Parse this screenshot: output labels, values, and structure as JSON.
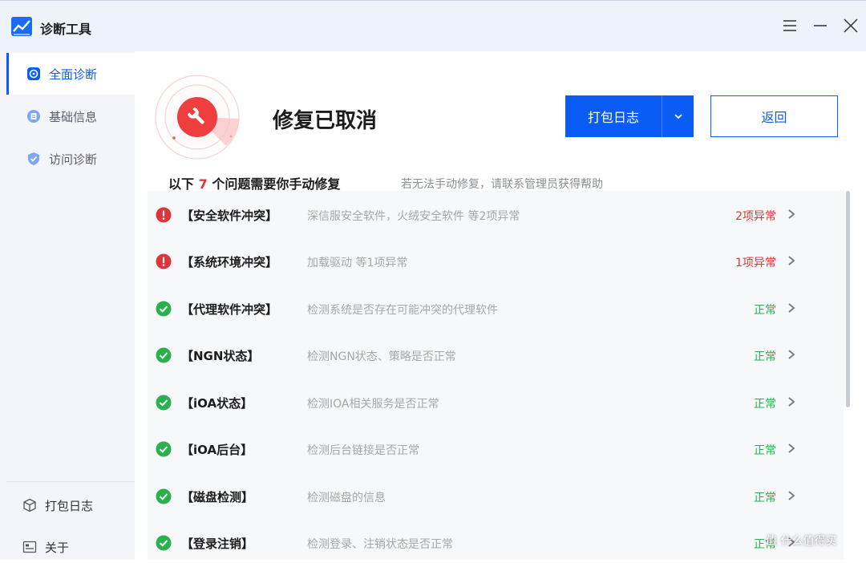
{
  "window": {
    "title": "诊断工具",
    "icons": {
      "app": "chart-line-icon",
      "menu": "menu-icon",
      "minimize": "minimize-icon",
      "close": "close-icon"
    }
  },
  "sidebar": {
    "items": [
      {
        "label": "全面诊断",
        "icon": "diagnose-icon",
        "active": true
      },
      {
        "label": "基础信息",
        "icon": "info-icon",
        "active": false
      },
      {
        "label": "访问诊断",
        "icon": "shield-icon",
        "active": false
      }
    ],
    "bottom": [
      {
        "label": "打包日志",
        "icon": "package-icon"
      },
      {
        "label": "关于",
        "icon": "about-icon"
      }
    ]
  },
  "header": {
    "status_title": "修复已取消",
    "pack_log_button": "打包日志",
    "back_button": "返回"
  },
  "summary": {
    "prefix": "以下",
    "count": "7",
    "suffix": "个问题需要你手动修复",
    "hint": "若无法手动修复，请联系管理员获得帮助"
  },
  "colors": {
    "accent": "#0a5cf5",
    "error": "#e0343b",
    "ok": "#2ab04e",
    "sidebar_bg": "#f3f5fa",
    "titlebar_bg": "#eef2fb"
  },
  "items": [
    {
      "name": "【安全软件冲突】",
      "desc": "深信服安全软件，火绒安全软件 等2项异常",
      "status": "2项异常",
      "state": "error"
    },
    {
      "name": "【系统环境冲突】",
      "desc": "加载驱动 等1项异常",
      "status": "1项异常",
      "state": "error"
    },
    {
      "name": "【代理软件冲突】",
      "desc": "检测系统是否存在可能冲突的代理软件",
      "status": "正常",
      "state": "ok"
    },
    {
      "name": "【NGN状态】",
      "desc": "检测NGN状态、策略是否正常",
      "status": "正常",
      "state": "ok"
    },
    {
      "name": "【iOA状态】",
      "desc": "检测IOA相关服务是否正常",
      "status": "正常",
      "state": "ok"
    },
    {
      "name": "【iOA后台】",
      "desc": "检测后台链接是否正常",
      "status": "正常",
      "state": "ok"
    },
    {
      "name": "【磁盘检测】",
      "desc": "检测磁盘的信息",
      "status": "正常",
      "state": "ok"
    },
    {
      "name": "【登录注销】",
      "desc": "检测登录、注销状态是否正常",
      "status": "正常",
      "state": "ok"
    }
  ],
  "watermark": "值 什么值得买"
}
